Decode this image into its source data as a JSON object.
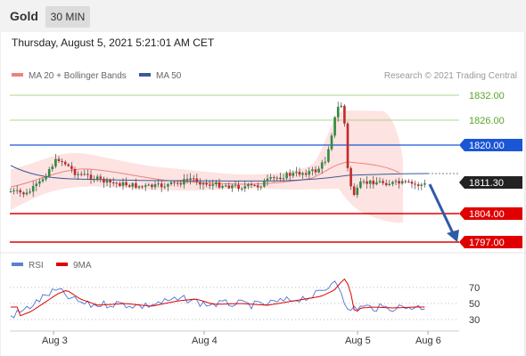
{
  "header": {
    "instrument": "Gold",
    "timeframe": "30 MIN"
  },
  "timestamp": "Thursday, August 5, 2021 5:21:01 AM CET",
  "legend": {
    "ma20": "MA 20 + Bollinger Bands",
    "ma50": "MA 50"
  },
  "credit": "Research © 2021 Trading Central",
  "colors": {
    "ma20": "#f08080",
    "ma50": "#3c5a99",
    "resistance": "#1a56d6",
    "support": "#e00000",
    "target_green": "#8fce6a",
    "current": "#222222",
    "rsi": "#5b7fd6",
    "rsi_ma": "#e00000",
    "arrow": "#2f5aa8"
  },
  "price_levels": [
    {
      "price": "1832.00",
      "style": "green"
    },
    {
      "price": "1826.00",
      "style": "green"
    },
    {
      "price": "1820.00",
      "style": "blue"
    },
    {
      "price": "1811.30",
      "style": "current"
    },
    {
      "price": "1804.00",
      "style": "red"
    },
    {
      "price": "1797.00",
      "style": "red"
    }
  ],
  "rsi": {
    "label": "RSI",
    "ma_label": "9MA",
    "levels": [
      "70",
      "50",
      "30"
    ]
  },
  "x_axis": [
    "Aug 3",
    "Aug 4",
    "Aug 5",
    "Aug 6"
  ]
}
